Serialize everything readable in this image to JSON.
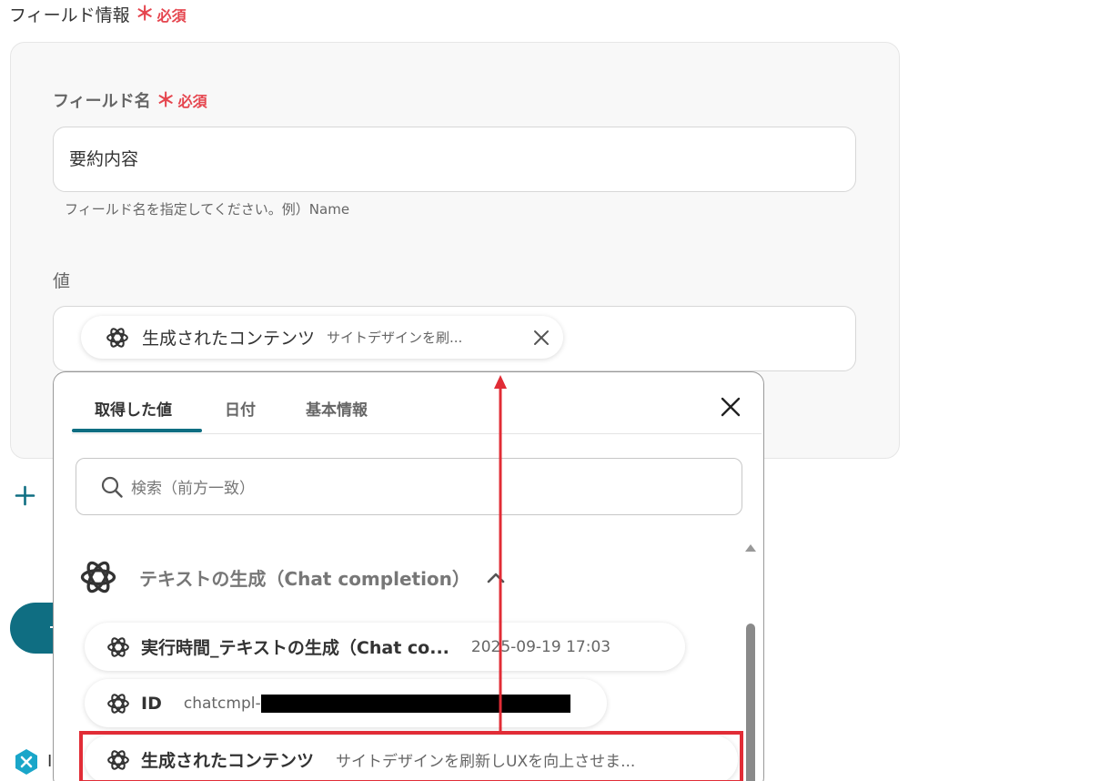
{
  "section": {
    "title": "フィールド情報",
    "required_star": "＊",
    "required_label": "必須"
  },
  "field_name": {
    "label": "フィールド名",
    "required_star": "＊",
    "required_label": "必須",
    "value": "要約内容",
    "hint": "フィールド名を指定してください。例）Name"
  },
  "value_field": {
    "label": "値",
    "chip": {
      "name": "生成されたコンテンツ",
      "preview": "サイトデザインを刷..."
    }
  },
  "dropdown": {
    "tabs": [
      {
        "label": "取得した値",
        "active": true
      },
      {
        "label": "日付",
        "active": false
      },
      {
        "label": "基本情報",
        "active": false
      }
    ],
    "search_placeholder": "検索（前方一致）",
    "group": {
      "title": "テキストの生成（Chat completion）",
      "items": [
        {
          "name": "実行時間_テキストの生成（Chat co...",
          "value": "2025-09-19 17:03"
        },
        {
          "name": "ID",
          "value": "chatcmpl-"
        },
        {
          "name": "生成されたコンテンツ",
          "value": "サイトデザインを刷新しUXを向上させま..."
        }
      ]
    }
  },
  "colors": {
    "accent": "#0f6e82",
    "required": "#e5454e",
    "highlight": "#e12c36"
  },
  "icons": {
    "openai": "openai-logo-icon",
    "close": "close-icon",
    "search": "search-icon",
    "plus": "plus-icon",
    "chevron": "chevron-up-icon"
  }
}
